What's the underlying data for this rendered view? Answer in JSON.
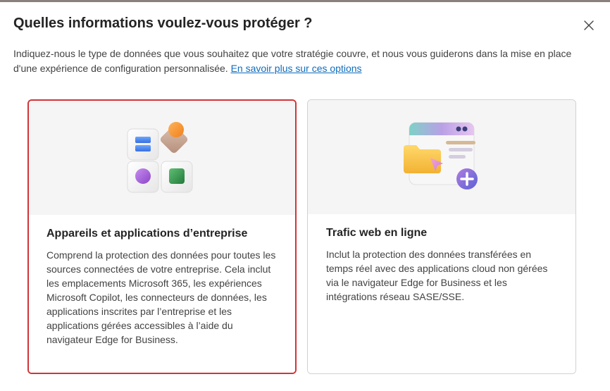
{
  "dialog": {
    "title": "Quelles informations voulez-vous protéger ?",
    "description": "Indiquez-nous le type de données que vous souhaitez que votre stratégie couvre, et nous vous guiderons dans la mise en place d'une expérience de configuration personnalisée. ",
    "link_label": "En savoir plus sur ces options",
    "close_icon": "close-icon"
  },
  "cards": [
    {
      "title": "Appareils et applications d’entreprise",
      "text": "Comprend la protection des données pour toutes les sources connectées de votre entreprise. Cela inclut les emplacements Microsoft 365, les expériences Microsoft Copilot, les connecteurs de données, les applications inscrites par l’entreprise et les applications gérées accessibles à l’aide du navigateur Edge for Business.",
      "selected": true,
      "icon": "apps-grid-icon"
    },
    {
      "title": "Trafic web en ligne",
      "text": "Inclut la protection des données transférées en temps réel avec des applications cloud non gérées via le navigateur Edge for Business et les intégrations réseau SASE/SSE.",
      "selected": false,
      "icon": "web-browser-icon"
    }
  ],
  "colors": {
    "accent_link": "#0f6cbd",
    "selected_border": "#d13438"
  }
}
